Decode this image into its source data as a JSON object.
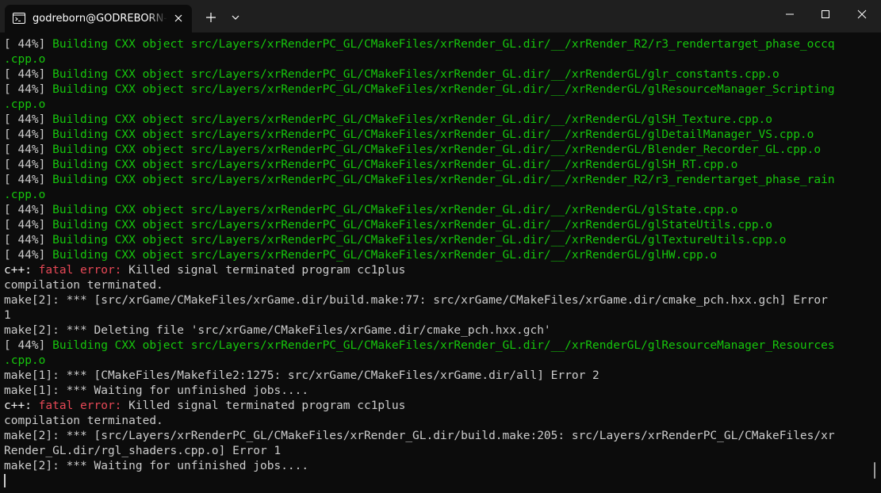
{
  "window": {
    "tab_title": "godreborn@GODREBORN-LPTOP: ~",
    "icons": {
      "tab": "terminal-icon",
      "tab_close": "close-icon",
      "new_tab": "plus-icon",
      "dropdown": "chevron-down-icon",
      "minimize": "minimize-icon",
      "maximize": "maximize-icon",
      "close": "close-window-icon"
    }
  },
  "colors": {
    "background": "#0c0c0c",
    "titlebar": "#1f1f1f",
    "text": "#cccccc",
    "progress_green": "#16c60c",
    "error_red": "#e74856"
  },
  "terminal": {
    "lines": [
      [
        {
          "t": "[ 44%] ",
          "c": "grey"
        },
        {
          "t": "Building CXX object src/Layers/xrRenderPC_GL/CMakeFiles/xrRender_GL.dir/__/xrRender_R2/r3_rendertarget_phase_occq",
          "c": "green"
        }
      ],
      [
        {
          "t": ".cpp.o",
          "c": "green"
        }
      ],
      [
        {
          "t": "[ 44%] ",
          "c": "grey"
        },
        {
          "t": "Building CXX object src/Layers/xrRenderPC_GL/CMakeFiles/xrRender_GL.dir/__/xrRenderGL/glr_constants.cpp.o",
          "c": "green"
        }
      ],
      [
        {
          "t": "[ 44%] ",
          "c": "grey"
        },
        {
          "t": "Building CXX object src/Layers/xrRenderPC_GL/CMakeFiles/xrRender_GL.dir/__/xrRenderGL/glResourceManager_Scripting",
          "c": "green"
        }
      ],
      [
        {
          "t": ".cpp.o",
          "c": "green"
        }
      ],
      [
        {
          "t": "[ 44%] ",
          "c": "grey"
        },
        {
          "t": "Building CXX object src/Layers/xrRenderPC_GL/CMakeFiles/xrRender_GL.dir/__/xrRenderGL/glSH_Texture.cpp.o",
          "c": "green"
        }
      ],
      [
        {
          "t": "[ 44%] ",
          "c": "grey"
        },
        {
          "t": "Building CXX object src/Layers/xrRenderPC_GL/CMakeFiles/xrRender_GL.dir/__/xrRenderGL/glDetailManager_VS.cpp.o",
          "c": "green"
        }
      ],
      [
        {
          "t": "[ 44%] ",
          "c": "grey"
        },
        {
          "t": "Building CXX object src/Layers/xrRenderPC_GL/CMakeFiles/xrRender_GL.dir/__/xrRenderGL/Blender_Recorder_GL.cpp.o",
          "c": "green"
        }
      ],
      [
        {
          "t": "[ 44%] ",
          "c": "grey"
        },
        {
          "t": "Building CXX object src/Layers/xrRenderPC_GL/CMakeFiles/xrRender_GL.dir/__/xrRenderGL/glSH_RT.cpp.o",
          "c": "green"
        }
      ],
      [
        {
          "t": "[ 44%] ",
          "c": "grey"
        },
        {
          "t": "Building CXX object src/Layers/xrRenderPC_GL/CMakeFiles/xrRender_GL.dir/__/xrRender_R2/r3_rendertarget_phase_rain",
          "c": "green"
        }
      ],
      [
        {
          "t": ".cpp.o",
          "c": "green"
        }
      ],
      [
        {
          "t": "[ 44%] ",
          "c": "grey"
        },
        {
          "t": "Building CXX object src/Layers/xrRenderPC_GL/CMakeFiles/xrRender_GL.dir/__/xrRenderGL/glState.cpp.o",
          "c": "green"
        }
      ],
      [
        {
          "t": "[ 44%] ",
          "c": "grey"
        },
        {
          "t": "Building CXX object src/Layers/xrRenderPC_GL/CMakeFiles/xrRender_GL.dir/__/xrRenderGL/glStateUtils.cpp.o",
          "c": "green"
        }
      ],
      [
        {
          "t": "[ 44%] ",
          "c": "grey"
        },
        {
          "t": "Building CXX object src/Layers/xrRenderPC_GL/CMakeFiles/xrRender_GL.dir/__/xrRenderGL/glTextureUtils.cpp.o",
          "c": "green"
        }
      ],
      [
        {
          "t": "[ 44%] ",
          "c": "grey"
        },
        {
          "t": "Building CXX object src/Layers/xrRenderPC_GL/CMakeFiles/xrRender_GL.dir/__/xrRenderGL/glHW.cpp.o",
          "c": "green"
        }
      ],
      [
        {
          "t": "c++: ",
          "c": "white"
        },
        {
          "t": "fatal error: ",
          "c": "red"
        },
        {
          "t": "Killed signal terminated program cc1plus",
          "c": "grey"
        }
      ],
      [
        {
          "t": "compilation terminated.",
          "c": "grey"
        }
      ],
      [
        {
          "t": "make[2]: *** [src/xrGame/CMakeFiles/xrGame.dir/build.make:77: src/xrGame/CMakeFiles/xrGame.dir/cmake_pch.hxx.gch] Error",
          "c": "grey"
        }
      ],
      [
        {
          "t": "1",
          "c": "grey"
        }
      ],
      [
        {
          "t": "make[2]: *** Deleting file 'src/xrGame/CMakeFiles/xrGame.dir/cmake_pch.hxx.gch'",
          "c": "grey"
        }
      ],
      [
        {
          "t": "[ 44%] ",
          "c": "grey"
        },
        {
          "t": "Building CXX object src/Layers/xrRenderPC_GL/CMakeFiles/xrRender_GL.dir/__/xrRenderGL/glResourceManager_Resources",
          "c": "green"
        }
      ],
      [
        {
          "t": ".cpp.o",
          "c": "green"
        }
      ],
      [
        {
          "t": "make[1]: *** [CMakeFiles/Makefile2:1275: src/xrGame/CMakeFiles/xrGame.dir/all] Error 2",
          "c": "grey"
        }
      ],
      [
        {
          "t": "make[1]: *** Waiting for unfinished jobs....",
          "c": "grey"
        }
      ],
      [
        {
          "t": "c++: ",
          "c": "white"
        },
        {
          "t": "fatal error: ",
          "c": "red"
        },
        {
          "t": "Killed signal terminated program cc1plus",
          "c": "grey"
        }
      ],
      [
        {
          "t": "compilation terminated.",
          "c": "grey"
        }
      ],
      [
        {
          "t": "make[2]: *** [src/Layers/xrRenderPC_GL/CMakeFiles/xrRender_GL.dir/build.make:205: src/Layers/xrRenderPC_GL/CMakeFiles/xr",
          "c": "grey"
        }
      ],
      [
        {
          "t": "Render_GL.dir/rgl_shaders.cpp.o] Error 1",
          "c": "grey"
        }
      ],
      [
        {
          "t": "make[2]: *** Waiting for unfinished jobs....",
          "c": "grey"
        }
      ]
    ]
  }
}
